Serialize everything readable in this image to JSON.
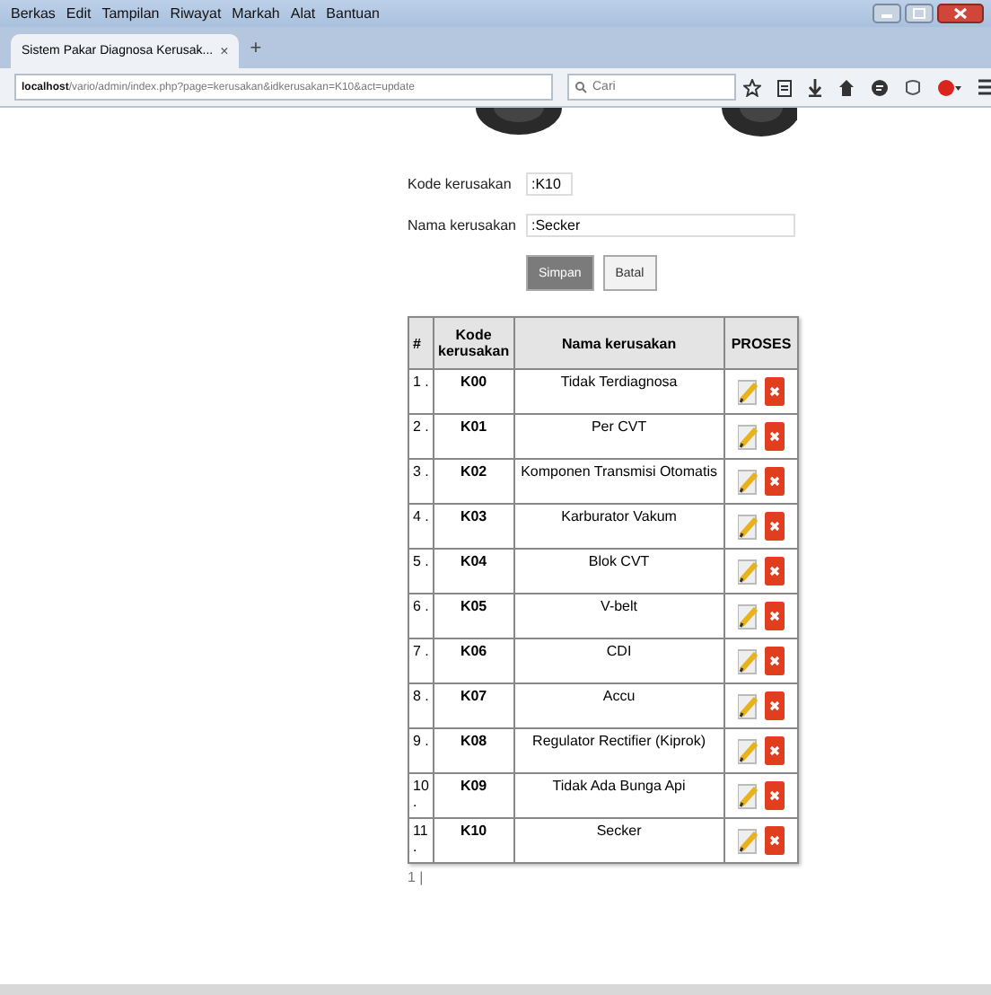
{
  "menu": [
    "Berkas",
    "Edit",
    "Tampilan",
    "Riwayat",
    "Markah",
    "Alat",
    "Bantuan"
  ],
  "tab": {
    "title": "Sistem Pakar Diagnosa Kerusak...",
    "close": "×",
    "new": "+"
  },
  "address": {
    "host": "localhost",
    "path": "/vario/admin/index.php?page=kerusakan&idkerusakan=K10&act=update"
  },
  "search": {
    "placeholder": "Cari"
  },
  "form": {
    "fields": [
      {
        "label": "Kode kerusakan",
        "value": ":K10",
        "kind": "short"
      },
      {
        "label": "Nama kerusakan",
        "value": ":Secker",
        "kind": "long"
      }
    ],
    "buttons": [
      {
        "label": "Simpan",
        "kind": "primary"
      },
      {
        "label": "Batal",
        "kind": "plain"
      }
    ]
  },
  "table": {
    "columns": [
      "#",
      "Kode kerusakan",
      "Nama kerusakan",
      "PROSES"
    ],
    "rows": [
      {
        "no": "1 .",
        "code": "K00",
        "name": "Tidak Terdiagnosa"
      },
      {
        "no": "2 .",
        "code": "K01",
        "name": "Per CVT"
      },
      {
        "no": "3 .",
        "code": "K02",
        "name": "Komponen Transmisi Otomatis"
      },
      {
        "no": "4 .",
        "code": "K03",
        "name": "Karburator Vakum"
      },
      {
        "no": "5 .",
        "code": "K04",
        "name": "Blok CVT"
      },
      {
        "no": "6 .",
        "code": "K05",
        "name": "V-belt"
      },
      {
        "no": "7 .",
        "code": "K06",
        "name": "CDI"
      },
      {
        "no": "8 .",
        "code": "K07",
        "name": "Accu"
      },
      {
        "no": "9 .",
        "code": "K08",
        "name": "Regulator Rectifier (Kiprok)"
      },
      {
        "no": "10 .",
        "code": "K09",
        "name": "Tidak Ada Bunga Api"
      },
      {
        "no": "11 .",
        "code": "K10",
        "name": "Secker"
      }
    ]
  },
  "pagination": "1 |"
}
